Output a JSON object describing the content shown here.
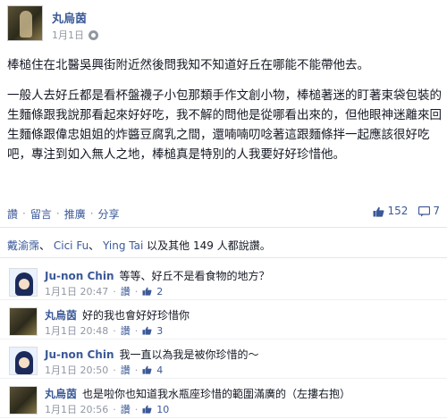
{
  "post": {
    "author": "丸烏茵",
    "date": "1月1日",
    "privacy_icon": "gear-icon",
    "paragraph1": "棒槌住在北醫吳興街附近然後問我知不知道好丘在哪能不能帶他去。",
    "paragraph2": "一般人去好丘都是看杯盤襪子小包那類手作文創小物，棒槌著迷的盯著束袋包裝的生麵條跟我說那看起來好好吃，我不解的問他是從哪看出來的，但他眼神迷離來回生麵條跟偉忠姐姐的炸醬豆腐乳之間，還喃喃叨唸著這跟麵條拌一起應該很好吃吧，專注到如入無人之地，棒槌真是特別的人我要好好珍惜他。"
  },
  "actions": {
    "like": "讚",
    "comment": "留言",
    "unfollow": "推廣",
    "share": "分享",
    "separator": "·",
    "like_count": "152",
    "comment_count": "7"
  },
  "likes_line": {
    "name1": "戴渝霈",
    "sep": "、",
    "name2": "Cici Fu",
    "name3": "Ying Tai",
    "suffix": "以及其他 149 人都說讚。"
  },
  "comments": [
    {
      "author": "Ju-non Chin",
      "text": "等等、好丘不是看食物的地方？",
      "time": "1月1日 20:47",
      "like": "讚",
      "count": "2",
      "avatar": "jun"
    },
    {
      "author": "丸烏茵",
      "text": "好的我也會好好珍惜你",
      "time": "1月1日 20:48",
      "like": "讚",
      "count": "3",
      "avatar": "owner"
    },
    {
      "author": "Ju-non Chin",
      "text": "我一直以為我是被你珍惜的～",
      "time": "1月1日 20:50",
      "like": "讚",
      "count": "4",
      "avatar": "jun"
    },
    {
      "author": "丸烏茵",
      "text": "也是啦你也知道我水瓶座珍惜的範圍滿廣的（左摟右抱）",
      "time": "1月1日 20:56",
      "like": "讚",
      "count": "10",
      "avatar": "owner"
    }
  ],
  "colors": {
    "link": "#3b5998",
    "meta": "#9197a3",
    "text": "#141823"
  }
}
